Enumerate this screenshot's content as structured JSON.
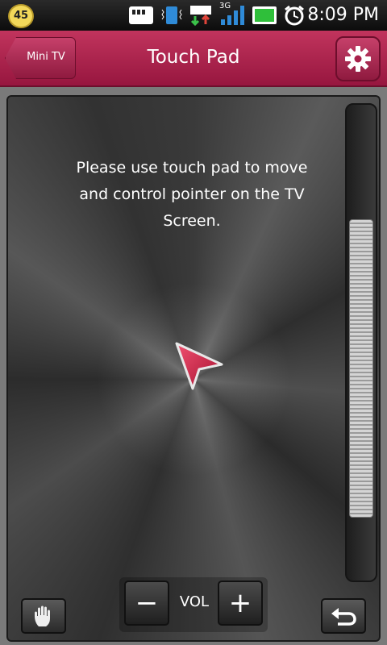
{
  "status_bar": {
    "notification_count": "45",
    "network": "3G",
    "time": "8:09 PM"
  },
  "header": {
    "back_label": "Mini TV",
    "title": "Touch Pad"
  },
  "touch_pad": {
    "instruction": "Please use touch pad to move and control pointer on the TV Screen."
  },
  "controls": {
    "vol_minus": "−",
    "vol_label": "VOL",
    "vol_plus": "+"
  },
  "colors": {
    "header": "#b1254f",
    "pointer": "#d8244f"
  }
}
